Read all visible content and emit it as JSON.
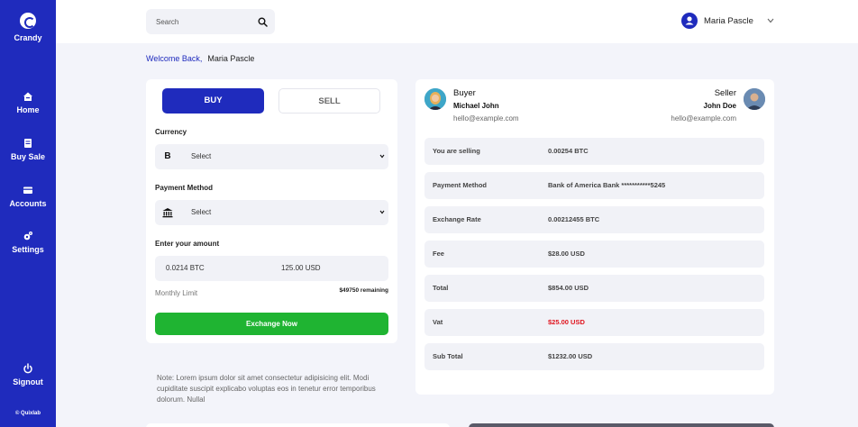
{
  "app": {
    "name": "Crandy",
    "footer": "© Quixlab"
  },
  "nav": {
    "items": [
      {
        "label": "Home",
        "icon": "home-icon"
      },
      {
        "label": "Buy Sale",
        "icon": "wallet-icon"
      },
      {
        "label": "Accounts",
        "icon": "card-icon"
      },
      {
        "label": "Settings",
        "icon": "gear-icon"
      }
    ],
    "signout": {
      "label": "Signout",
      "icon": "power-icon"
    }
  },
  "search": {
    "placeholder": "Search"
  },
  "user": {
    "name": "Maria Pascle"
  },
  "welcome": {
    "lead": "Welcome Back,",
    "name": "Maria Pascle"
  },
  "trade": {
    "tabs": [
      "BUY",
      "SELL"
    ],
    "currency_label": "Currency",
    "currency_value": "Select",
    "currency_icon": "B",
    "payment_label": "Payment Method",
    "payment_value": "Select",
    "amount_label": "Enter your amount",
    "amount_btc": "0.0214 BTC",
    "amount_usd": "125.00 USD",
    "limit_label": "Monthly Limit",
    "limit_remaining": "$49750 remaining",
    "button": "Exchange Now",
    "note": "Note: Lorem ipsum dolor sit amet consectetur adipisicing elit. Modi cupiditate suscipit explicabo voluptas eos in tenetur error temporibus dolorum. Nullal"
  },
  "parties": {
    "buyer": {
      "role": "Buyer",
      "name": "Michael John",
      "email": "hello@example.com"
    },
    "seller": {
      "role": "Seller",
      "name": "John Doe",
      "email": "hello@example.com"
    }
  },
  "details": [
    {
      "label": "You are selling",
      "value": "0.00254 BTC"
    },
    {
      "label": "Payment Method",
      "value": "Bank of America Bank ***********5245"
    },
    {
      "label": "Exchange Rate",
      "value": "0.00212455 BTC"
    },
    {
      "label": "Fee",
      "value": "$28.00 USD"
    },
    {
      "label": "Total",
      "value": "$854.00 USD"
    },
    {
      "label": "Vat",
      "value": "$25.00 USD",
      "color": "#e0141e"
    },
    {
      "label": "Sub Total",
      "value": "$1232.00 USD"
    }
  ],
  "colors": {
    "primary": "#1f2bbd",
    "success": "#1fb432",
    "danger": "#e0141e",
    "background": "#f3f4fa"
  }
}
